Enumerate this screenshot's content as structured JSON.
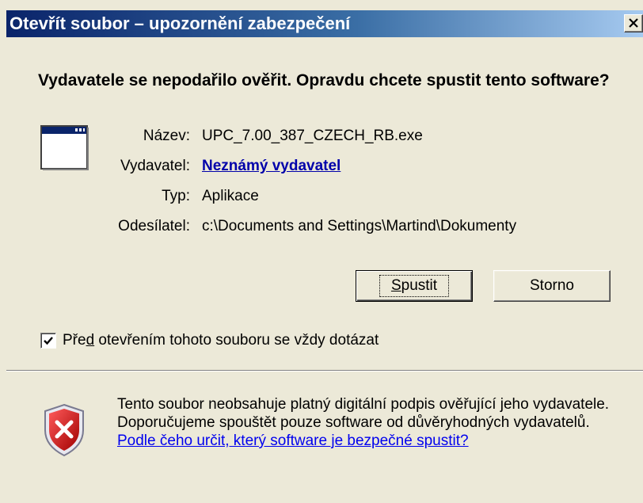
{
  "window": {
    "title": "Otevřít soubor – upozornění zabezpečení",
    "close_label": "×"
  },
  "heading": "Vydavatele se nepodařilo ověřit. Opravdu chcete spustit tento software?",
  "file_info": {
    "name_label": "Název:",
    "name_value": "UPC_7.00_387_CZECH_RB.exe",
    "publisher_label": "Vydavatel:",
    "publisher_value": "Neznámý vydavatel",
    "type_label": "Typ:",
    "type_value": "Aplikace",
    "from_label": "Odesílatel:",
    "from_value": "c:\\Documents and Settings\\Martind\\Dokumenty"
  },
  "buttons": {
    "run_label_hotkey": "S",
    "run_label_rest": "pustit",
    "cancel_label": "Storno"
  },
  "checkbox": {
    "checked": true,
    "label_pre": "Pře",
    "label_hotkey": "d",
    "label_post": " otevřením tohoto souboru se vždy dotázat"
  },
  "warning": {
    "text": "Tento soubor neobsahuje platný digitální podpis ověřující jeho vydavatele. Doporučujeme spouštět pouze software od důvěryhodných vydavatelů. ",
    "link": "Podle čeho určit, který software je bezpečné spustit?"
  },
  "colors": {
    "titlebar_start": "#0a246a",
    "titlebar_end": "#a6caf0",
    "dialog_bg": "#ece9d8",
    "link": "#0000ee",
    "shield_red": "#cc0000"
  },
  "icons": {
    "app": "application-window-icon",
    "shield": "security-shield-error-icon",
    "check": "checkmark-icon",
    "close": "close-icon"
  }
}
